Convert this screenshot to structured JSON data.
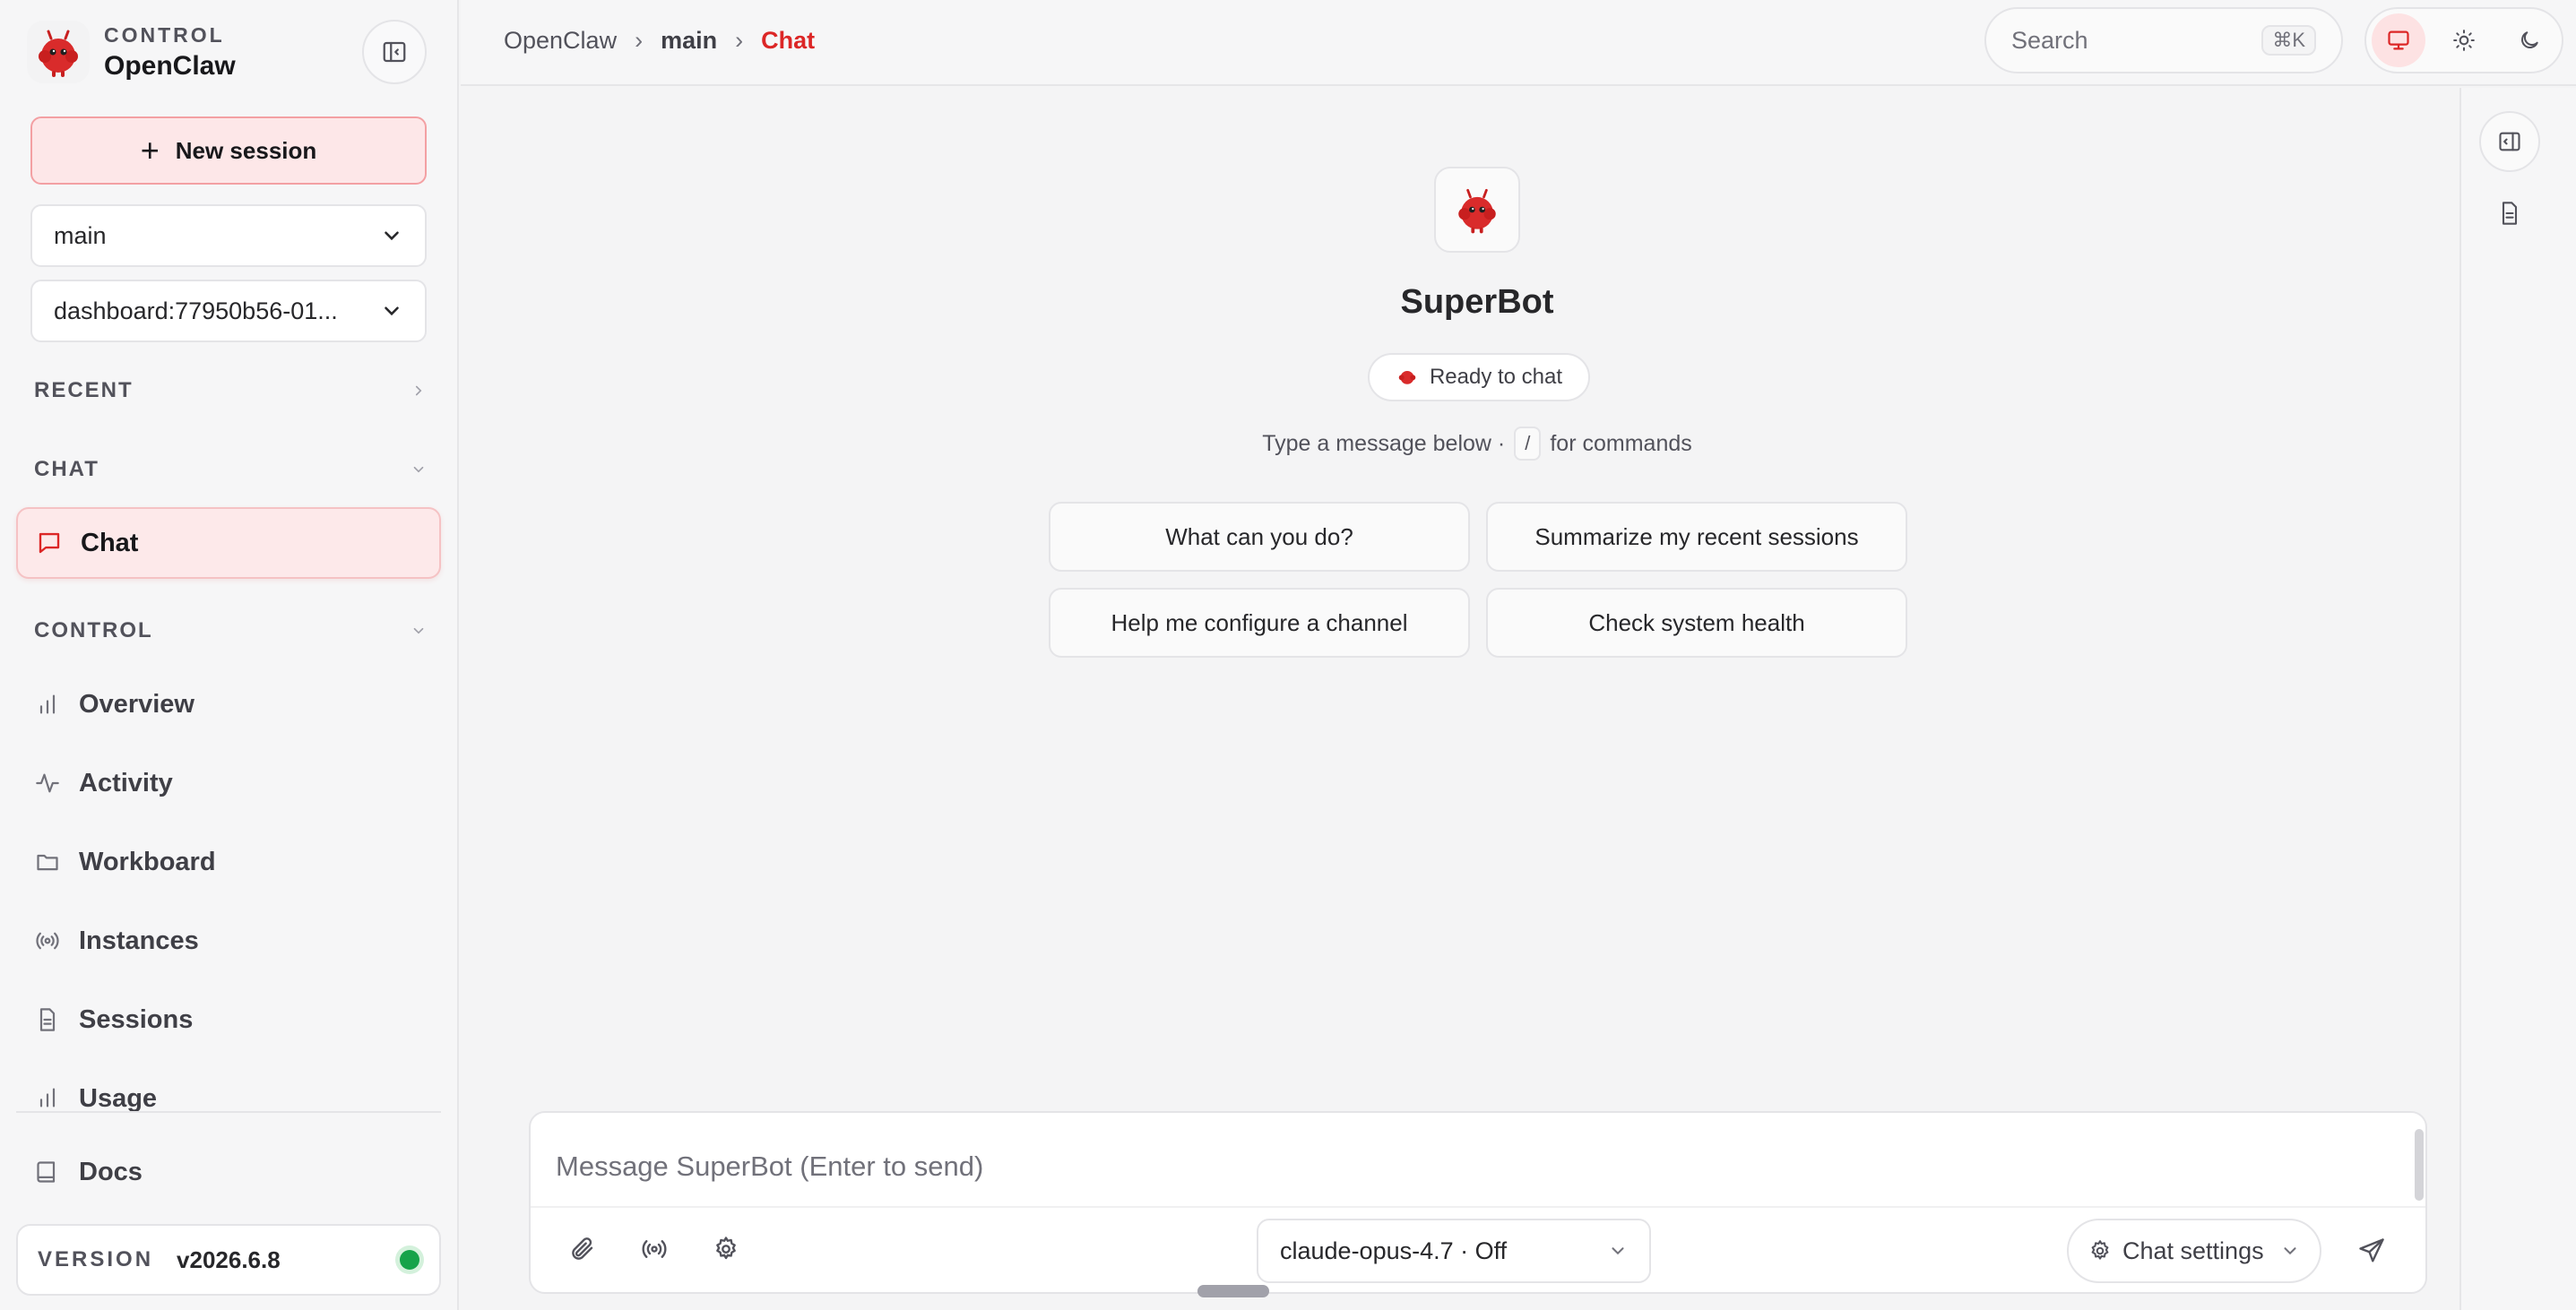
{
  "sidebar": {
    "brand": {
      "kicker": "CONTROL",
      "name": "OpenClaw"
    },
    "new_session_label": "New session",
    "agent_select": "main",
    "session_select": "dashboard:77950b56-01...",
    "sections": {
      "recent": "RECENT",
      "chat": "CHAT",
      "control": "CONTROL"
    },
    "active_item": {
      "label": "Chat",
      "icon": "message-square-icon"
    },
    "items": [
      {
        "label": "Overview",
        "icon": "bar-chart-icon"
      },
      {
        "label": "Activity",
        "icon": "activity-icon"
      },
      {
        "label": "Workboard",
        "icon": "folder-icon"
      },
      {
        "label": "Instances",
        "icon": "broadcast-icon"
      },
      {
        "label": "Sessions",
        "icon": "file-text-icon"
      },
      {
        "label": "Usage",
        "icon": "bar-chart-icon"
      }
    ],
    "docs_label": "Docs",
    "version": {
      "key": "VERSION",
      "value": "v2026.6.8",
      "status_color": "#16a34a"
    }
  },
  "topbar": {
    "breadcrumb": [
      "OpenClaw",
      "main",
      "Chat"
    ],
    "breadcrumb_sep": "›",
    "search": {
      "placeholder": "Search",
      "shortcut": "⌘K"
    },
    "theme": {
      "active": "system",
      "options": [
        "system",
        "light",
        "dark"
      ]
    }
  },
  "main": {
    "bot_name": "SuperBot",
    "status": "Ready to chat",
    "hint": {
      "before": "Type a message below ·",
      "key": "/",
      "after": "for commands"
    },
    "suggestions": [
      "What can you do?",
      "Summarize my recent sessions",
      "Help me configure a channel",
      "Check system health"
    ]
  },
  "composer": {
    "placeholder": "Message SuperBot (Enter to send)",
    "value": "",
    "model": "claude-opus-4.7 · Off",
    "chat_settings_label": "Chat settings"
  },
  "colors": {
    "accent": "#dc2626",
    "accent_soft": "#fde7e8",
    "online": "#16a34a"
  }
}
